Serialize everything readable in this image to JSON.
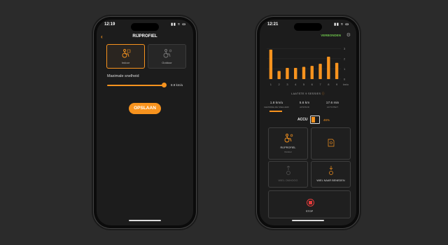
{
  "phone1": {
    "status_time": "12:19",
    "status_icons": "▮▮ ≈ ▭",
    "back_icon": "chevron-left",
    "title": "RIJPROFIEL",
    "modes": [
      {
        "label": "Indoor",
        "icon": "wheelchair-user-indoor",
        "selected": true
      },
      {
        "label": "Outdoor",
        "icon": "wheelchair-user-outdoor-sun",
        "selected": false
      }
    ],
    "max_speed_label": "Maximale snelheid",
    "max_speed_value": "8.9 km/u",
    "max_speed_fraction": 0.95,
    "save_label": "OPSLAAN"
  },
  "phone2": {
    "status_time": "12:21",
    "status_icons": "▮▮ ≈ ▭",
    "connection_status": "VERBONDEN",
    "connection_color": "#6cc04a",
    "settings_icon": "gear",
    "chart_data": {
      "type": "bar",
      "categories": [
        "1",
        "2",
        "3",
        "4",
        "5",
        "6",
        "7",
        "8",
        "9"
      ],
      "values": [
        2.9,
        0.8,
        1.1,
        1.1,
        1.2,
        1.3,
        1.5,
        2.2,
        1.6
      ],
      "y_ticks": [
        "3",
        "2",
        "1",
        "0"
      ],
      "y_unit": "km/u",
      "ylim": [
        0,
        3.3
      ],
      "bar_color": "#f7931e"
    },
    "sessions_label": "LAATSTE 9 SESSIES",
    "stats": [
      {
        "value": "1.8 km/u",
        "label": "GEMIDDELDE SNELHEID",
        "active": true
      },
      {
        "value": "5.6 km",
        "label": "AFSTAND",
        "active": false
      },
      {
        "value": "17.6 min",
        "label": "ACTIVITEIT",
        "active": false
      }
    ],
    "accu_label": "ACCU",
    "battery_percent_text": "46%",
    "battery_level": 0.46,
    "tiles": {
      "profile_label": "RIJPROFIEL",
      "profile_sub": "Outdoor",
      "wheel_up_label": "WIEL OMHOOG",
      "wheel_down_label": "WIEL NAAR BENEDEN",
      "stop_label": "STOP"
    },
    "accent_color": "#f7931e"
  }
}
